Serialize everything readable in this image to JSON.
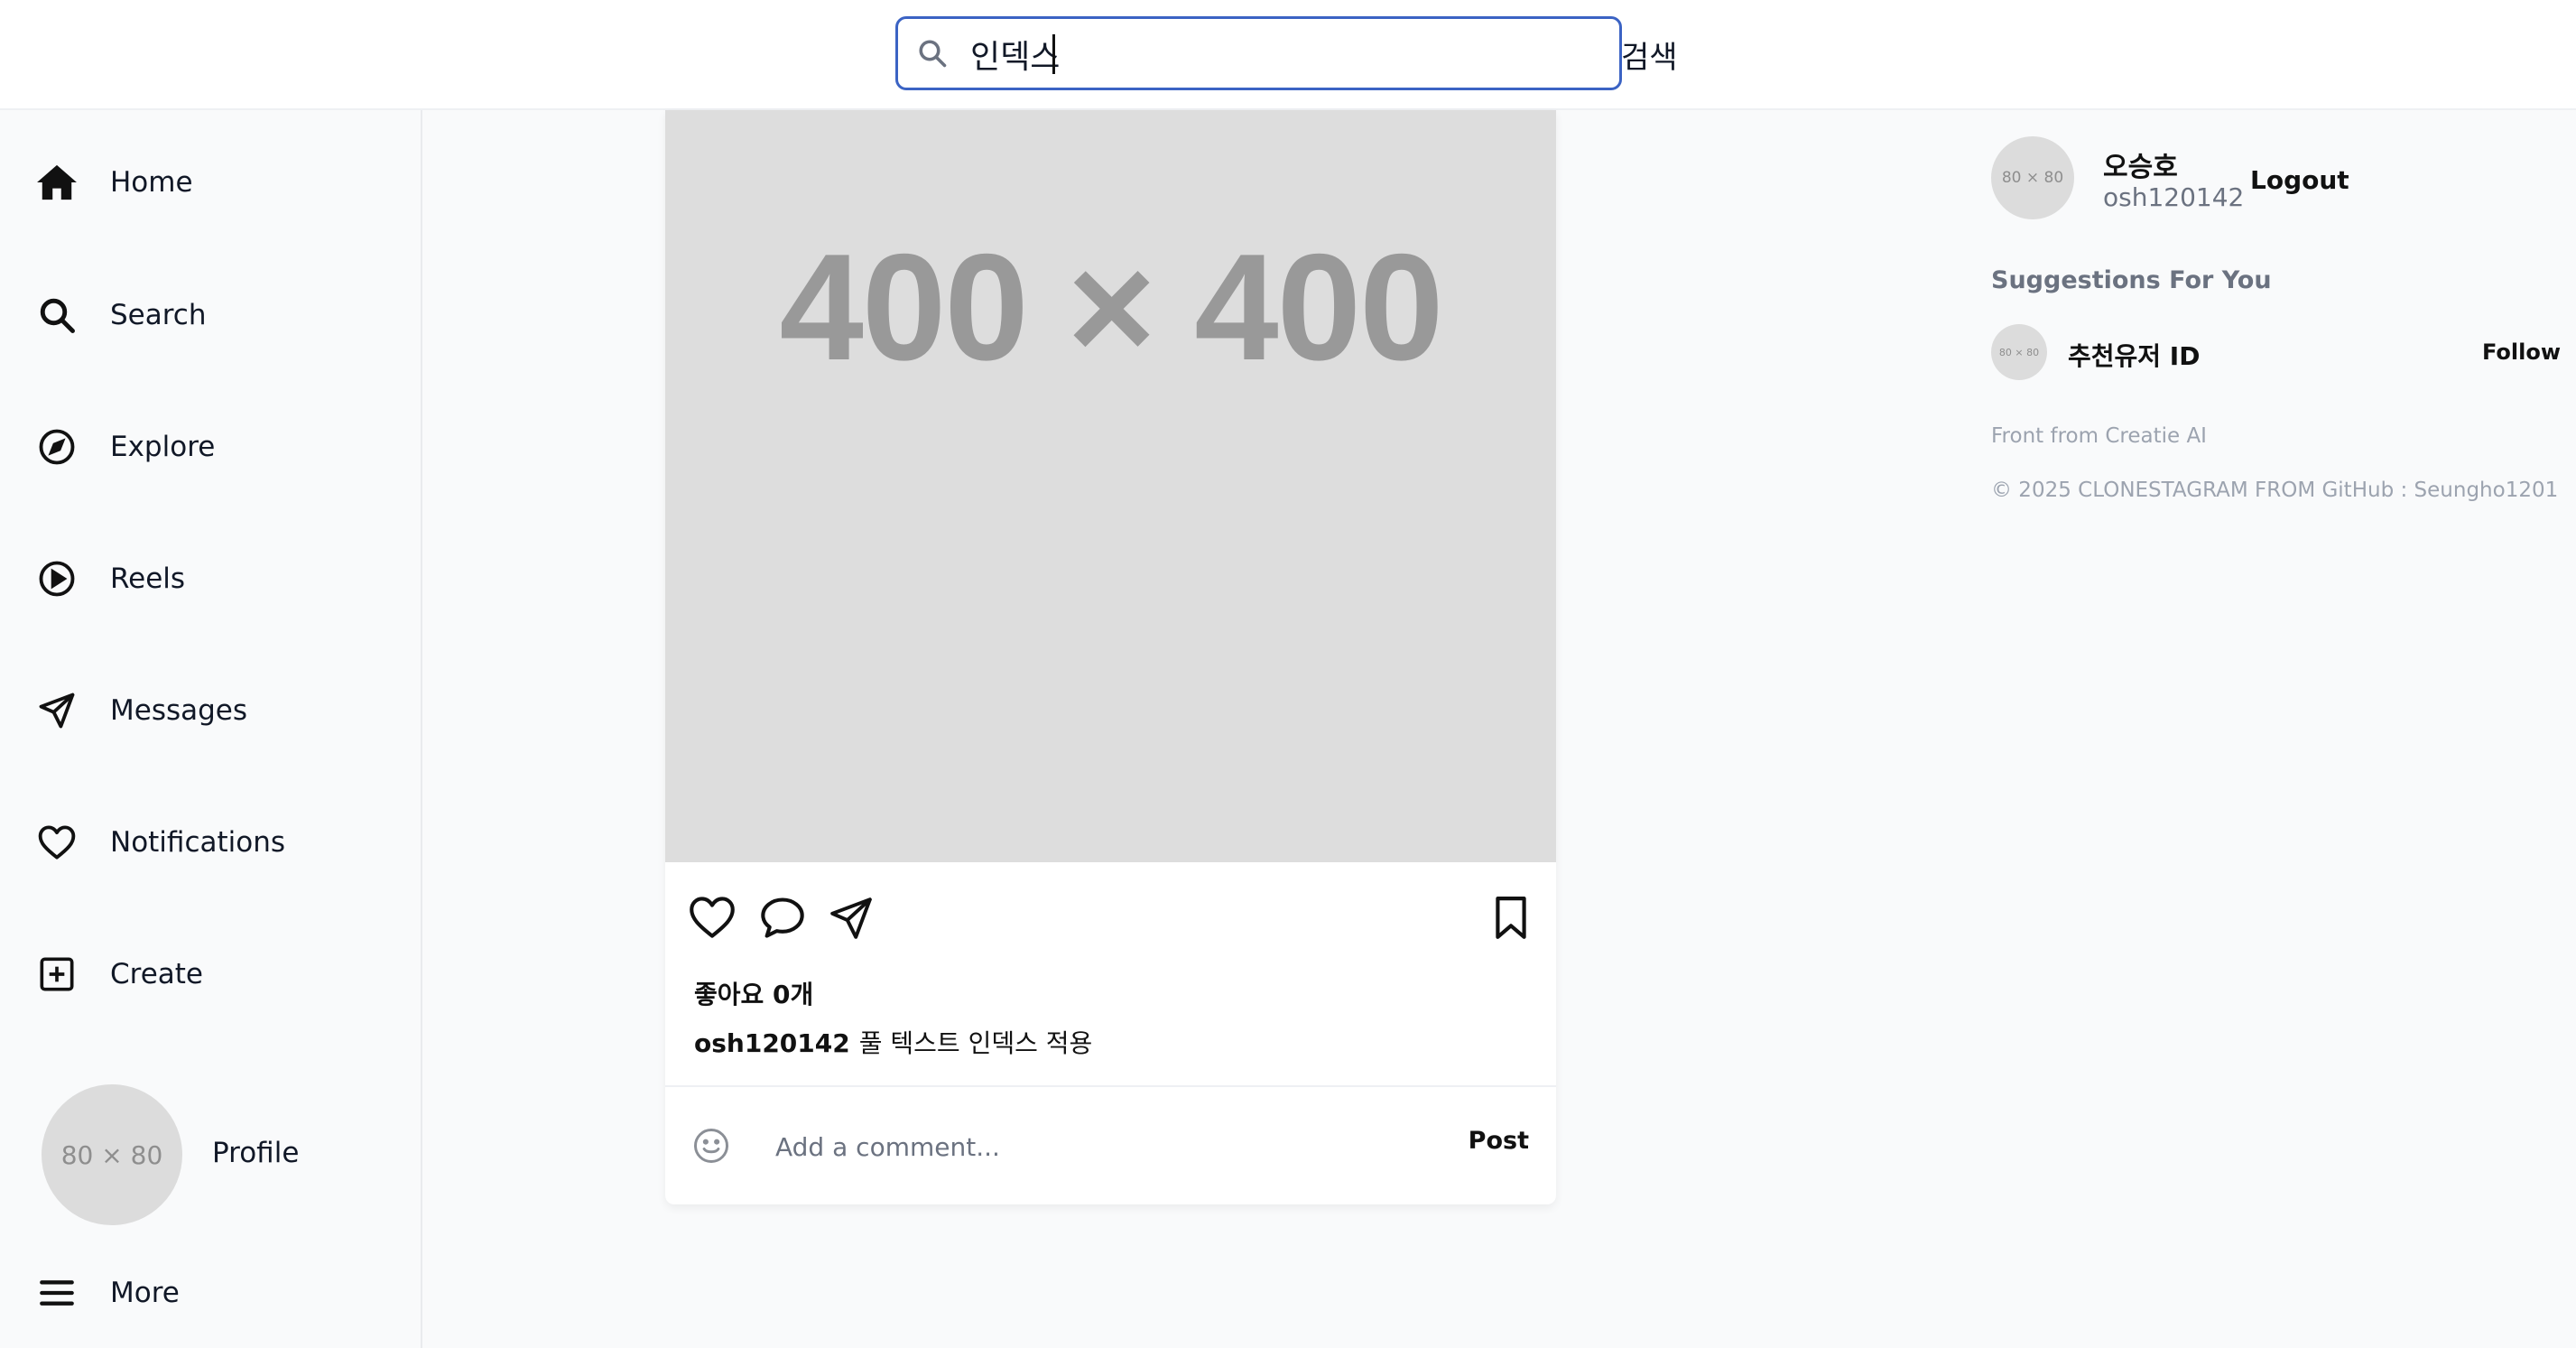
{
  "search": {
    "value": "인덱스",
    "submit_label": "검색"
  },
  "sidebar": {
    "items": [
      {
        "label": "Home",
        "icon": "home-icon"
      },
      {
        "label": "Search",
        "icon": "search-icon"
      },
      {
        "label": "Explore",
        "icon": "compass-icon"
      },
      {
        "label": "Reels",
        "icon": "play-circle-icon"
      },
      {
        "label": "Messages",
        "icon": "send-icon"
      },
      {
        "label": "Notifications",
        "icon": "heart-icon"
      },
      {
        "label": "Create",
        "icon": "plus-square-icon"
      }
    ],
    "profile": {
      "label": "Profile",
      "avatar_text": "80 × 80"
    },
    "more": {
      "label": "More",
      "icon": "menu-icon"
    }
  },
  "post": {
    "image_placeholder": "400 × 400",
    "likes": "좋아요 0개",
    "username": "osh120142",
    "caption": "풀 텍스트 인덱스 적용",
    "comment_placeholder": "Add a comment...",
    "post_label": "Post"
  },
  "right": {
    "me": {
      "avatar_text": "80 × 80",
      "name": "오승호",
      "id": "osh120142",
      "logout_label": "Logout"
    },
    "suggestions_title": "Suggestions For You",
    "suggestion": {
      "avatar_text": "80 × 80",
      "name": "추천유저 ID",
      "follow_label": "Follow"
    },
    "footer_line1": "Front from Creatie AI",
    "footer_line2": "© 2025 CLONESTAGRAM FROM GitHub : Seungho1201"
  },
  "colors": {
    "accent_border": "#3b63c4",
    "background": "#f9fafb",
    "placeholder_gray": "#dddddd"
  }
}
